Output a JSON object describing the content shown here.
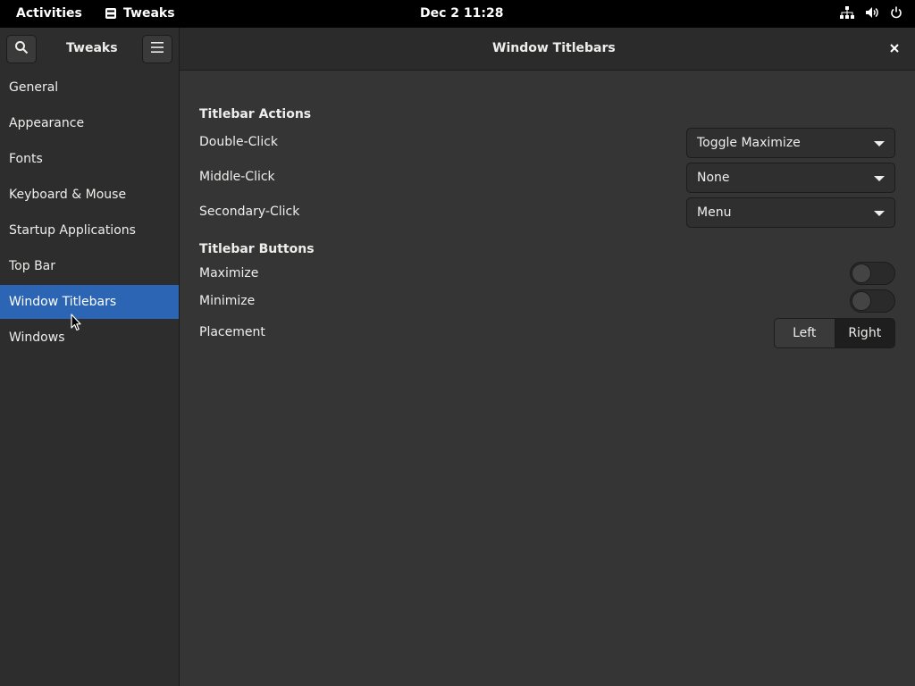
{
  "topbar": {
    "activities": "Activities",
    "app_name": "Tweaks",
    "clock": "Dec 2  11:28",
    "icons": [
      "network-icon",
      "volume-icon",
      "power-icon"
    ]
  },
  "headerbar": {
    "app_title": "Tweaks",
    "page_title": "Window Titlebars",
    "icons": [
      "search-icon",
      "hamburger-menu-icon",
      "close-icon"
    ]
  },
  "sidebar": {
    "items": [
      {
        "label": "General",
        "selected": false
      },
      {
        "label": "Appearance",
        "selected": false
      },
      {
        "label": "Fonts",
        "selected": false
      },
      {
        "label": "Keyboard & Mouse",
        "selected": false
      },
      {
        "label": "Startup Applications",
        "selected": false
      },
      {
        "label": "Top Bar",
        "selected": false
      },
      {
        "label": "Window Titlebars",
        "selected": true
      },
      {
        "label": "Windows",
        "selected": false
      }
    ]
  },
  "content": {
    "actions_title": "Titlebar Actions",
    "double_click": {
      "label": "Double-Click",
      "value": "Toggle Maximize"
    },
    "middle_click": {
      "label": "Middle-Click",
      "value": "None"
    },
    "secondary_click": {
      "label": "Secondary-Click",
      "value": "Menu"
    },
    "buttons_title": "Titlebar Buttons",
    "maximize": {
      "label": "Maximize",
      "enabled": false
    },
    "minimize": {
      "label": "Minimize",
      "enabled": false
    },
    "placement": {
      "label": "Placement",
      "options": [
        "Left",
        "Right"
      ],
      "selected": "Right"
    }
  },
  "colors": {
    "accent": "#2b65b4",
    "background": "#353535",
    "sidebar": "#2d2d2d",
    "topbar": "#000000"
  }
}
